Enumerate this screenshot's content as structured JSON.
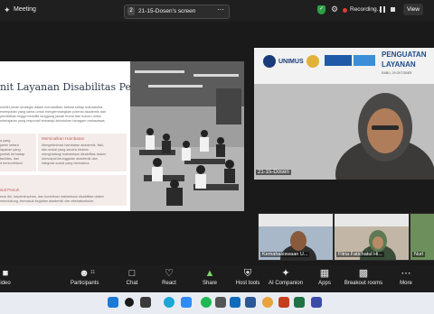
{
  "titlebar": {
    "app_title": "Meeting",
    "tab_number": "2",
    "tab_label": "21-15-Dosen's screen",
    "recording_label": "Recording...",
    "view_label": "View"
  },
  "slide": {
    "title": "nit Layanan Disabilitas Penting?",
    "intro_lines": [
      "emiliki peran strategis dalam memastikan bahwa setiap mahasiswa,",
      "esempatan yang sama untuk mengembangkan potensi akademik dan",
      "pendidikan tinggi memiliki tanggung jawab moral dan hukum untuk",
      "mbelajaran yang responsif terhadap kebutuhan beragam mahasiswa."
    ],
    "box_left_lines": [
      "a yang",
      "jamin setara",
      "layanan yang",
      "jumlah terhadap",
      "fasilitas, dan",
      "d berkontribusi"
    ],
    "box_right_title": "Meminalkan Hambatan",
    "box_right_lines": [
      "Mengeliminasi hambatan akademik, fisik,",
      "dan sosial yang secara historis",
      "menghalangi mahasiswa disabilitas dalam",
      "mencapai keunggulan akademik dan",
      "integrasi sosial yang bermakna."
    ],
    "bottom_title": "sial Penuh",
    "bottom_lines": [
      "ensi diri, kepemimpinan, dan kontribusi mahasiswa disabilitas dalam",
      "mendukung, termasuk kegiatan akademik dan ekstrakurikuler."
    ]
  },
  "dosen": {
    "name_label": "21-15-Dosen",
    "banner_line1": "PENGUATAN",
    "banner_line2": "LAYANAN",
    "banner_date": "RABU, 29 OKTOBER",
    "logo_text": "UNIMUS"
  },
  "thumbnails": [
    {
      "label": "Kemahasiswaan U..."
    },
    {
      "label": "Fitria Fatichatul Hi..."
    },
    {
      "label": "Nurl"
    }
  ],
  "controls": [
    {
      "name": "video",
      "label": "ideo",
      "icon": "video-camera-icon"
    },
    {
      "name": "participants",
      "label": "Participants",
      "icon": "participants-icon",
      "count": "11"
    },
    {
      "name": "chat",
      "label": "Chat",
      "icon": "chat-bubble-icon"
    },
    {
      "name": "react",
      "label": "React",
      "icon": "heart-icon"
    },
    {
      "name": "share",
      "label": "Share",
      "icon": "share-screen-icon"
    },
    {
      "name": "host-tools",
      "label": "Host tools",
      "icon": "shield-icon"
    },
    {
      "name": "ai-companion",
      "label": "AI Companion",
      "icon": "sparkle-icon"
    },
    {
      "name": "apps",
      "label": "Apps",
      "icon": "apps-icon"
    },
    {
      "name": "breakout-rooms",
      "label": "Breakout rooms",
      "icon": "breakout-rooms-icon"
    },
    {
      "name": "more",
      "label": "More",
      "icon": "ellipsis-icon"
    }
  ],
  "colors": {
    "share_green": "#7fd36a",
    "recording_red": "#e03c3c",
    "slide_title": "#2f3a4e",
    "slide_subtitle": "#c06060",
    "banner_blue": "#1e4c8a"
  }
}
